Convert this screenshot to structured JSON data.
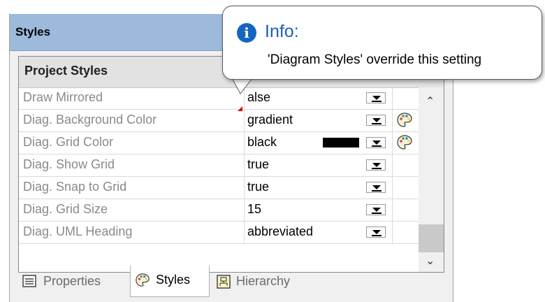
{
  "panel": {
    "title": "Styles"
  },
  "grid": {
    "header": "Project Styles",
    "rows": [
      {
        "name": "Draw Mirrored",
        "value": "alse"
      },
      {
        "name": "Diag. Background Color",
        "value": "gradient"
      },
      {
        "name": "Diag. Grid Color",
        "value": "black"
      },
      {
        "name": "Diag. Show Grid",
        "value": "true"
      },
      {
        "name": "Diag. Snap to Grid",
        "value": "true"
      },
      {
        "name": "Diag. Grid Size",
        "value": "15"
      },
      {
        "name": "Diag. UML Heading",
        "value": "abbreviated"
      }
    ],
    "grid_color_swatch": "#000000"
  },
  "tabs": [
    {
      "label": "Properties",
      "icon": "properties-icon",
      "active": false
    },
    {
      "label": "Styles",
      "icon": "palette-icon",
      "active": true
    },
    {
      "label": "Hierarchy",
      "icon": "hierarchy-icon",
      "active": false
    }
  ],
  "tooltip": {
    "icon": "info-icon",
    "title": "Info:",
    "message": "'Diagram Styles' override this setting"
  },
  "colors": {
    "titlebar": "#9db9dc",
    "info_blue": "#1565c0",
    "override_marker": "#e00000"
  }
}
